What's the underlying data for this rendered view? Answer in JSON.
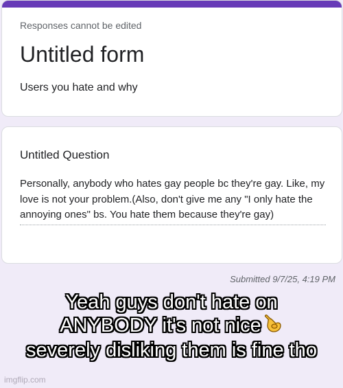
{
  "header": {
    "notice": "Responses cannot be edited",
    "title": "Untitled form",
    "description": "Users you hate and why",
    "accent_color": "#673ab7"
  },
  "question": {
    "title": "Untitled Question",
    "answer": "Personally, anybody who hates gay people bc they're gay. Like, my love is not your problem.(Also, don't give me any \"I only hate the annoying ones\" bs. You hate them because they're gay)"
  },
  "footer": {
    "submitted": "Submitted 9/7/25, 4:19 PM"
  },
  "caption": {
    "line1": "Yeah guys don't hate on",
    "line2": "ANYBODY it's not nice",
    "line3": "severely disliking them is fine tho",
    "emoji_icon": "pointing-hand-icon"
  },
  "watermark": "imgflip.com",
  "colors": {
    "background": "#f0ebf8",
    "card": "#ffffff"
  }
}
